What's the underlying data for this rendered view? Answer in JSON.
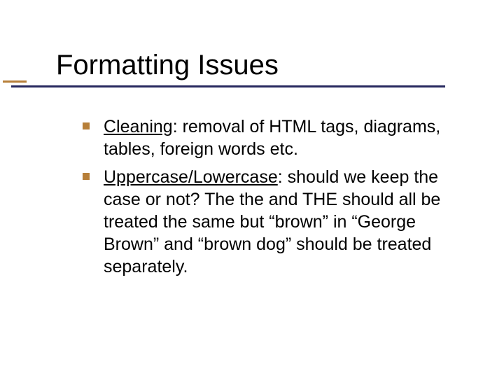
{
  "title": "Formatting Issues",
  "items": [
    {
      "lead": "Cleaning",
      "rest": ": removal of HTML tags, diagrams, tables, foreign words etc."
    },
    {
      "lead": "Uppercase/Lowercase",
      "rest": ": should we keep the case or not? The the and THE should all be treated the same but “brown” in “George Brown” and “brown dog” should be treated separately."
    }
  ]
}
